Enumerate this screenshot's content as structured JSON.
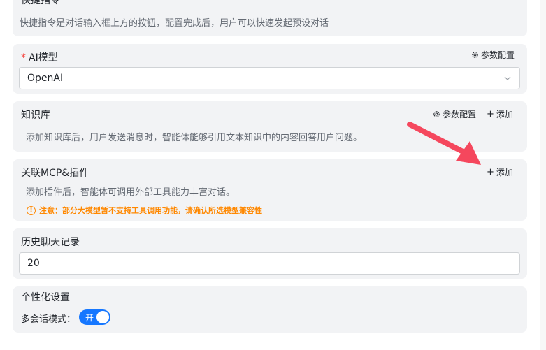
{
  "quick_commands": {
    "title": "快捷指令",
    "description": "快捷指令是对话输入框上方的按钮，配置完成后，用户可以快速发起预设对话"
  },
  "ai_model": {
    "required_mark": "*",
    "title": "AI模型",
    "param_config_label": "参数配置",
    "selected_model": "OpenAI"
  },
  "knowledge_base": {
    "title": "知识库",
    "param_config_label": "参数配置",
    "add_label": "添加",
    "description": "添加知识库后，用户发送消息时，智能体能够引用文本知识中的内容回答用户问题。"
  },
  "mcp_plugins": {
    "title": "关联MCP&插件",
    "add_label": "添加",
    "description": "添加插件后，智能体可调用外部工具能力丰富对话。",
    "warning": "注意：部分大模型暂不支持工具调用功能，请确认所选模型兼容性"
  },
  "chat_history": {
    "title": "历史聊天记录",
    "value": "20"
  },
  "personalization": {
    "title": "个性化设置",
    "multi_session_label": "多会话模式：",
    "toggle_label": "开",
    "toggle_on": true
  },
  "colors": {
    "accent": "#1677ff",
    "warning": "#ff8800",
    "annotation_arrow": "#f5475d",
    "required": "#f54a45"
  },
  "icons": [
    "gear-icon",
    "plus-icon",
    "chevron-down-icon",
    "warning-circle-icon",
    "annotation-arrow"
  ]
}
